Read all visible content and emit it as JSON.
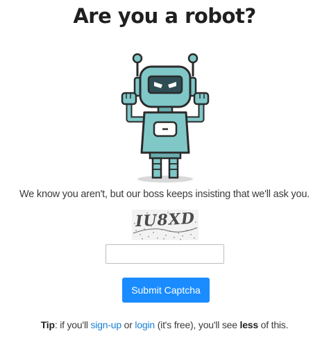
{
  "page": {
    "title": "Are you a robot?",
    "message": "We know you aren't, but our boss keeps insisting that we'll ask you."
  },
  "robot": {
    "icon": "robot-icon",
    "colors": {
      "body": "#80c7c8",
      "outline": "#2a2a2a",
      "shadow": "#d9d9d9",
      "eyes": "#ffffff"
    }
  },
  "captcha": {
    "image_text": "IU8XD",
    "input_value": "",
    "input_placeholder": ""
  },
  "submit": {
    "label": "Submit Captcha",
    "color": "#1a8cff"
  },
  "tip": {
    "prefix": "Tip",
    "text1": ": if you'll ",
    "signup_label": "sign-up",
    "text2": " or ",
    "login_label": "login",
    "text3": " (it's free), you'll see ",
    "less": "less",
    "text4": " of this.",
    "link_color": "#1a7fd6"
  }
}
